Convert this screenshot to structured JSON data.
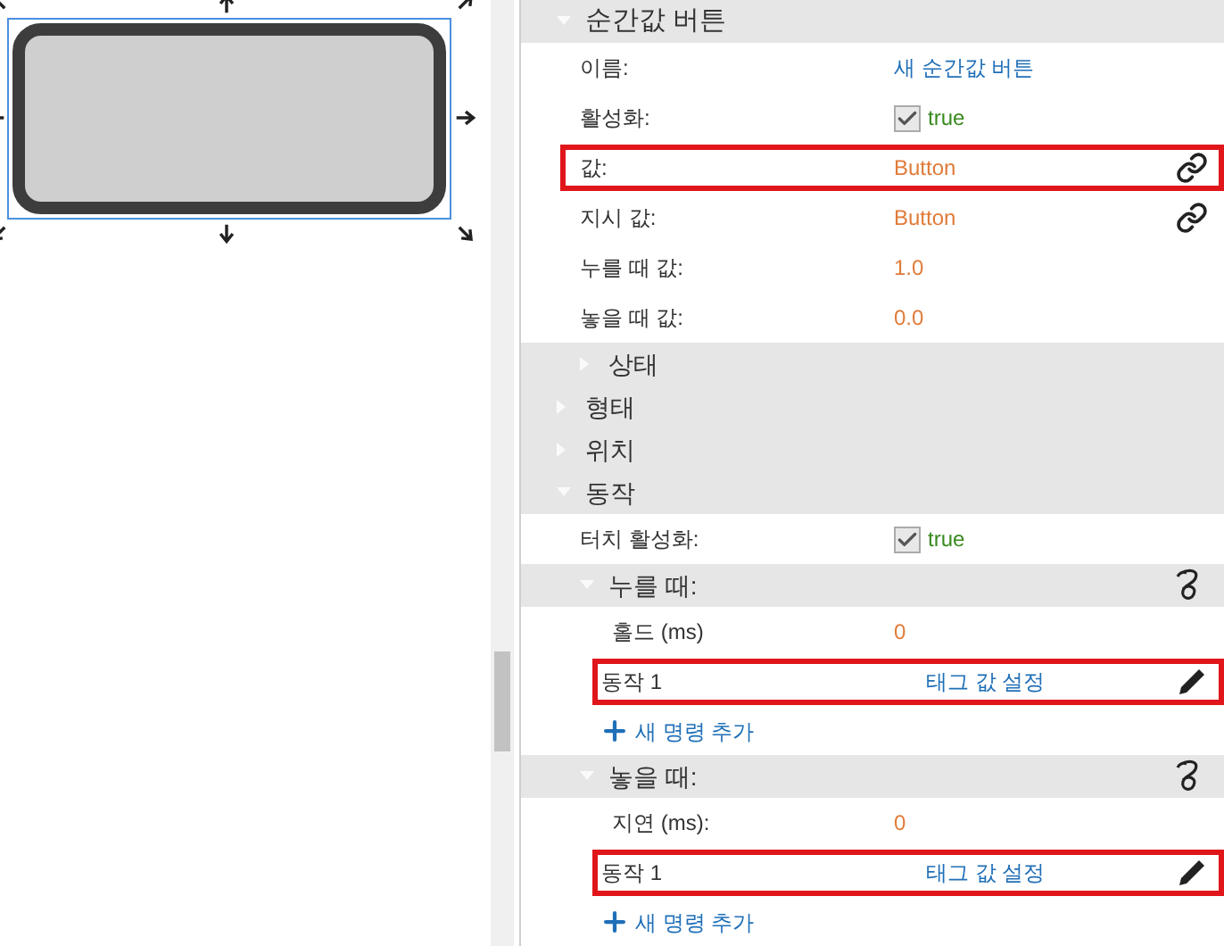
{
  "canvas": {
    "widget_selected": true
  },
  "tree": [
    {
      "kind": "group",
      "label": "순간값 버튼",
      "expanded": true,
      "script": false,
      "children": [
        {
          "kind": "text",
          "label": "이름:",
          "value": "새 순간값 버튼",
          "linked": false,
          "highlighted": false
        },
        {
          "kind": "checkbox",
          "label": "활성화:",
          "value": "true",
          "checked": true,
          "linked": false,
          "highlighted": false
        },
        {
          "kind": "number",
          "label": "값:",
          "value": "Button",
          "linked": true,
          "highlighted": true
        },
        {
          "kind": "number",
          "label": "지시 값:",
          "value": "Button",
          "linked": true,
          "highlighted": false
        },
        {
          "kind": "number",
          "label": "누를 때 값:",
          "value": "1.0",
          "linked": false,
          "highlighted": false
        },
        {
          "kind": "number",
          "label": "놓을 때 값:",
          "value": "0.0",
          "linked": false,
          "highlighted": false
        },
        {
          "kind": "group",
          "label": "상태",
          "expanded": false,
          "script": false
        }
      ]
    },
    {
      "kind": "group",
      "label": "형태",
      "expanded": false,
      "script": false
    },
    {
      "kind": "group",
      "label": "위치",
      "expanded": false,
      "script": false
    },
    {
      "kind": "group",
      "label": "동작",
      "expanded": true,
      "script": false,
      "children": [
        {
          "kind": "checkbox",
          "label": "터치 활성화:",
          "value": "true",
          "checked": true,
          "linked": false,
          "highlighted": false
        },
        {
          "kind": "group",
          "label": "누를 때:",
          "expanded": true,
          "script": true,
          "children": [
            {
              "kind": "number",
              "label": "홀드 (ms)",
              "value": "0",
              "linked": false,
              "highlighted": false
            },
            {
              "kind": "action",
              "label": "동작 1",
              "value": "태그 값 설정",
              "highlighted": true
            },
            {
              "kind": "add",
              "label": "새 명령 추가"
            }
          ]
        },
        {
          "kind": "group",
          "label": "놓을 때:",
          "expanded": true,
          "script": true,
          "children": [
            {
              "kind": "number",
              "label": "지연 (ms):",
              "value": "0",
              "linked": false,
              "highlighted": false
            },
            {
              "kind": "action",
              "label": "동작 1",
              "value": "태그 값 설정",
              "highlighted": true
            },
            {
              "kind": "add",
              "label": "새 명령 추가"
            }
          ]
        }
      ]
    }
  ]
}
